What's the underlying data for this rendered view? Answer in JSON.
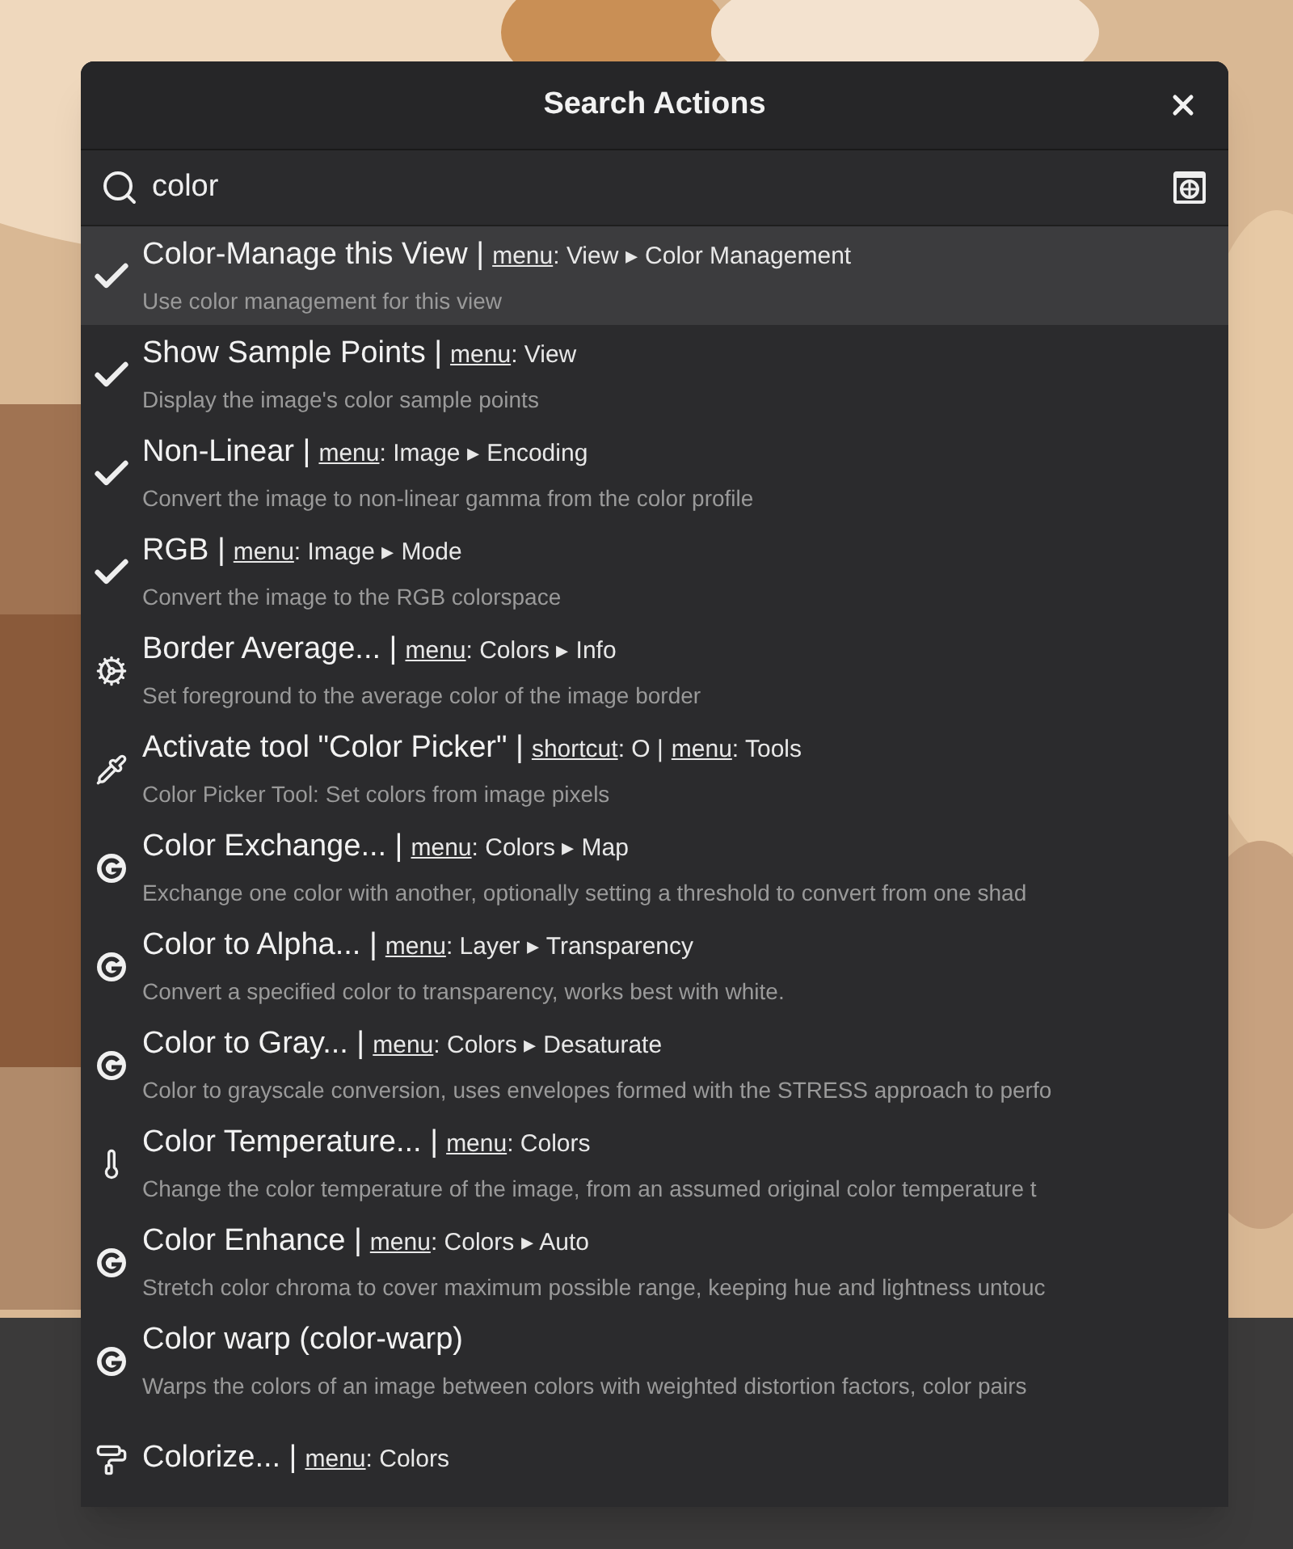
{
  "dialog": {
    "title": "Search Actions"
  },
  "search": {
    "value": "color"
  },
  "results": [
    {
      "kind": "toggle",
      "checked": true,
      "selected": true,
      "title": "Color-Manage this View |",
      "parts": [
        {
          "key": "menu",
          "value": ": View ▸ Color Management"
        }
      ],
      "description": "Use color management for this view"
    },
    {
      "kind": "toggle",
      "checked": true,
      "selected": false,
      "title": "Show Sample Points |",
      "parts": [
        {
          "key": "menu",
          "value": ": View"
        }
      ],
      "description": "Display the image's color sample points"
    },
    {
      "kind": "toggle",
      "checked": true,
      "selected": false,
      "title": "Non-Linear |",
      "parts": [
        {
          "key": "menu",
          "value": ": Image ▸ Encoding"
        }
      ],
      "description": "Convert the image to non-linear gamma from the color profile"
    },
    {
      "kind": "toggle",
      "checked": true,
      "selected": false,
      "title": "RGB |",
      "parts": [
        {
          "key": "menu",
          "value": ": Image ▸ Mode"
        }
      ],
      "description": "Convert the image to the RGB colorspace"
    },
    {
      "kind": "gear",
      "selected": false,
      "title": "Border Average... |",
      "parts": [
        {
          "key": "menu",
          "value": ": Colors ▸ Info"
        }
      ],
      "description": "Set foreground to the average color of the image border"
    },
    {
      "kind": "pipette",
      "selected": false,
      "title": "Activate tool \"Color Picker\" |",
      "parts": [
        {
          "key": "shortcut",
          "value": ": O |"
        },
        {
          "key": "menu",
          "value": ": Tools"
        }
      ],
      "description": "Color Picker Tool: Set colors from image pixels"
    },
    {
      "kind": "gegl",
      "selected": false,
      "title": "Color Exchange... |",
      "parts": [
        {
          "key": "menu",
          "value": ": Colors ▸ Map"
        }
      ],
      "description": "Exchange one color with another, optionally setting a threshold to convert from one shad"
    },
    {
      "kind": "gegl",
      "selected": false,
      "title": "Color to Alpha... |",
      "parts": [
        {
          "key": "menu",
          "value": ": Layer ▸ Transparency"
        }
      ],
      "description": "Convert a specified color to transparency, works best with white."
    },
    {
      "kind": "gegl",
      "selected": false,
      "title": "Color to Gray... |",
      "parts": [
        {
          "key": "menu",
          "value": ": Colors ▸ Desaturate"
        }
      ],
      "description": "Color to grayscale conversion, uses envelopes formed with the STRESS approach to perfo"
    },
    {
      "kind": "thermometer",
      "selected": false,
      "title": "Color Temperature... |",
      "parts": [
        {
          "key": "menu",
          "value": ": Colors"
        }
      ],
      "description": "Change the color temperature of the image, from an assumed original color temperature t"
    },
    {
      "kind": "gegl",
      "selected": false,
      "title": "Color Enhance |",
      "parts": [
        {
          "key": "menu",
          "value": ": Colors ▸ Auto"
        }
      ],
      "description": "Stretch color chroma to cover maximum possible range, keeping hue and lightness untouc"
    },
    {
      "kind": "gegl",
      "selected": false,
      "title": "Color warp (color-warp)",
      "description": "Warps the colors of an image between colors with weighted distortion factors, color pairs"
    },
    {
      "kind": "roller",
      "selected": false,
      "title": "Colorize... |",
      "parts": [
        {
          "key": "menu",
          "value": ": Colors"
        }
      ]
    }
  ]
}
